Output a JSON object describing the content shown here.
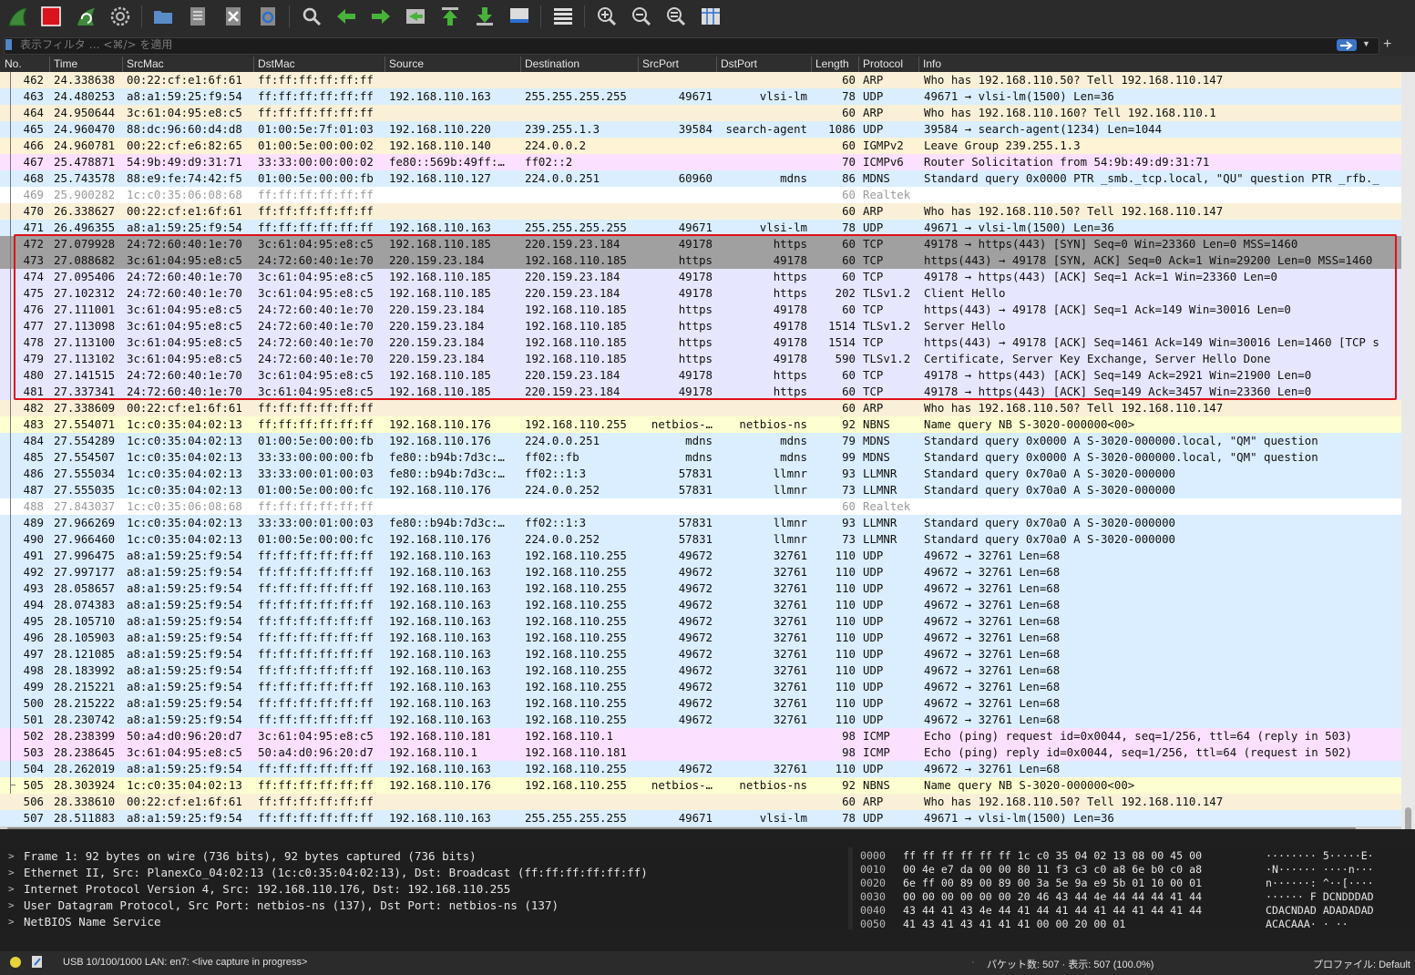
{
  "toolbar": {
    "buttons": [
      "shark-fin-start-icon",
      "stop-square-icon",
      "restart-capture-icon",
      "capture-options-gear-icon",
      "open-folder-icon",
      "save-file-icon",
      "close-file-icon",
      "reload-file-icon",
      "find-packet-icon",
      "go-back-arrow-icon",
      "go-forward-arrow-icon",
      "go-to-packet-icon",
      "go-first-packet-icon",
      "go-last-packet-icon",
      "autoscroll-icon",
      "colorize-icon",
      "zoom-in-icon",
      "zoom-out-icon",
      "zoom-normal-icon",
      "resize-columns-icon"
    ]
  },
  "filter": {
    "placeholder": "表示フィルタ … <⌘/> を適用"
  },
  "columns": [
    "No.",
    "Time",
    "SrcMac",
    "DstMac",
    "Source",
    "Destination",
    "SrcPort",
    "DstPort",
    "Length",
    "Protocol",
    "Info"
  ],
  "packets": [
    [
      "462",
      "24.338638",
      "00:22:cf:e1:6f:61",
      "ff:ff:ff:ff:ff:ff",
      "",
      "",
      "",
      "",
      "60",
      "ARP",
      "Who has 192.168.110.50? Tell 192.168.110.147",
      "arp"
    ],
    [
      "463",
      "24.480253",
      "a8:a1:59:25:f9:54",
      "ff:ff:ff:ff:ff:ff",
      "192.168.110.163",
      "255.255.255.255",
      "49671",
      "vlsi-lm",
      "78",
      "UDP",
      "49671 → vlsi-lm(1500) Len=36",
      "udp"
    ],
    [
      "464",
      "24.950644",
      "3c:61:04:95:e8:c5",
      "ff:ff:ff:ff:ff:ff",
      "",
      "",
      "",
      "",
      "60",
      "ARP",
      "Who has 192.168.110.160? Tell 192.168.110.1",
      "arp"
    ],
    [
      "465",
      "24.960470",
      "88:dc:96:60:d4:d8",
      "01:00:5e:7f:01:03",
      "192.168.110.220",
      "239.255.1.3",
      "39584",
      "search-agent",
      "1086",
      "UDP",
      "39584 → search-agent(1234) Len=1044",
      "udp"
    ],
    [
      "466",
      "24.960781",
      "00:22:cf:e6:82:65",
      "01:00:5e:00:00:02",
      "192.168.110.140",
      "224.0.0.2",
      "",
      "",
      "60",
      "IGMPv2",
      "Leave Group 239.255.1.3",
      "igmp"
    ],
    [
      "467",
      "25.478871",
      "54:9b:49:d9:31:71",
      "33:33:00:00:00:02",
      "fe80::569b:49ff:…",
      "ff02::2",
      "",
      "",
      "70",
      "ICMPv6",
      "Router Solicitation from 54:9b:49:d9:31:71",
      "icmp"
    ],
    [
      "468",
      "25.743578",
      "88:e9:fe:74:42:f5",
      "01:00:5e:00:00:fb",
      "192.168.110.127",
      "224.0.0.251",
      "60960",
      "mdns",
      "86",
      "MDNS",
      "Standard query 0x0000 PTR _smb._tcp.local, \"QU\" question PTR _rfb._",
      "udp"
    ],
    [
      "469",
      "25.900282",
      "1c:c0:35:06:08:68",
      "ff:ff:ff:ff:ff:ff",
      "",
      "",
      "",
      "",
      "60",
      "Realtek",
      "",
      "rtk"
    ],
    [
      "470",
      "26.338627",
      "00:22:cf:e1:6f:61",
      "ff:ff:ff:ff:ff:ff",
      "",
      "",
      "",
      "",
      "60",
      "ARP",
      "Who has 192.168.110.50? Tell 192.168.110.147",
      "arp"
    ],
    [
      "471",
      "26.496355",
      "a8:a1:59:25:f9:54",
      "ff:ff:ff:ff:ff:ff",
      "192.168.110.163",
      "255.255.255.255",
      "49671",
      "vlsi-lm",
      "78",
      "UDP",
      "49671 → vlsi-lm(1500) Len=36",
      "udp"
    ],
    [
      "472",
      "27.079928",
      "24:72:60:40:1e:70",
      "3c:61:04:95:e8:c5",
      "192.168.110.185",
      "220.159.23.184",
      "49178",
      "https",
      "60",
      "TCP",
      "49178 → https(443) [SYN] Seq=0 Win=23360 Len=0 MSS=1460",
      "syn"
    ],
    [
      "473",
      "27.088682",
      "3c:61:04:95:e8:c5",
      "24:72:60:40:1e:70",
      "220.159.23.184",
      "192.168.110.185",
      "https",
      "49178",
      "60",
      "TCP",
      "https(443) → 49178 [SYN, ACK] Seq=0 Ack=1 Win=29200 Len=0 MSS=1460",
      "syn"
    ],
    [
      "474",
      "27.095406",
      "24:72:60:40:1e:70",
      "3c:61:04:95:e8:c5",
      "192.168.110.185",
      "220.159.23.184",
      "49178",
      "https",
      "60",
      "TCP",
      "49178 → https(443) [ACK] Seq=1 Ack=1 Win=23360 Len=0",
      "tcp"
    ],
    [
      "475",
      "27.102312",
      "24:72:60:40:1e:70",
      "3c:61:04:95:e8:c5",
      "192.168.110.185",
      "220.159.23.184",
      "49178",
      "https",
      "202",
      "TLSv1.2",
      "Client Hello",
      "tcp"
    ],
    [
      "476",
      "27.111001",
      "3c:61:04:95:e8:c5",
      "24:72:60:40:1e:70",
      "220.159.23.184",
      "192.168.110.185",
      "https",
      "49178",
      "60",
      "TCP",
      "https(443) → 49178 [ACK] Seq=1 Ack=149 Win=30016 Len=0",
      "tcp"
    ],
    [
      "477",
      "27.113098",
      "3c:61:04:95:e8:c5",
      "24:72:60:40:1e:70",
      "220.159.23.184",
      "192.168.110.185",
      "https",
      "49178",
      "1514",
      "TLSv1.2",
      "Server Hello",
      "tcp"
    ],
    [
      "478",
      "27.113100",
      "3c:61:04:95:e8:c5",
      "24:72:60:40:1e:70",
      "220.159.23.184",
      "192.168.110.185",
      "https",
      "49178",
      "1514",
      "TCP",
      "https(443) → 49178 [ACK] Seq=1461 Ack=149 Win=30016 Len=1460 [TCP s",
      "tcp"
    ],
    [
      "479",
      "27.113102",
      "3c:61:04:95:e8:c5",
      "24:72:60:40:1e:70",
      "220.159.23.184",
      "192.168.110.185",
      "https",
      "49178",
      "590",
      "TLSv1.2",
      "Certificate, Server Key Exchange, Server Hello Done",
      "tcp"
    ],
    [
      "480",
      "27.141515",
      "24:72:60:40:1e:70",
      "3c:61:04:95:e8:c5",
      "192.168.110.185",
      "220.159.23.184",
      "49178",
      "https",
      "60",
      "TCP",
      "49178 → https(443) [ACK] Seq=149 Ack=2921 Win=21900 Len=0",
      "tcp"
    ],
    [
      "481",
      "27.337341",
      "24:72:60:40:1e:70",
      "3c:61:04:95:e8:c5",
      "192.168.110.185",
      "220.159.23.184",
      "49178",
      "https",
      "60",
      "TCP",
      "49178 → https(443) [ACK] Seq=149 Ack=3457 Win=23360 Len=0",
      "tcp"
    ],
    [
      "482",
      "27.338609",
      "00:22:cf:e1:6f:61",
      "ff:ff:ff:ff:ff:ff",
      "",
      "",
      "",
      "",
      "60",
      "ARP",
      "Who has 192.168.110.50? Tell 192.168.110.147",
      "arp"
    ],
    [
      "483",
      "27.554071",
      "1c:c0:35:04:02:13",
      "ff:ff:ff:ff:ff:ff",
      "192.168.110.176",
      "192.168.110.255",
      "netbios-…",
      "netbios-ns",
      "92",
      "NBNS",
      "Name query NB S-3020-000000<00>",
      "nbns"
    ],
    [
      "484",
      "27.554289",
      "1c:c0:35:04:02:13",
      "01:00:5e:00:00:fb",
      "192.168.110.176",
      "224.0.0.251",
      "mdns",
      "mdns",
      "79",
      "MDNS",
      "Standard query 0x0000 A S-3020-000000.local, \"QM\" question",
      "udp"
    ],
    [
      "485",
      "27.554507",
      "1c:c0:35:04:02:13",
      "33:33:00:00:00:fb",
      "fe80::b94b:7d3c:…",
      "ff02::fb",
      "mdns",
      "mdns",
      "99",
      "MDNS",
      "Standard query 0x0000 A S-3020-000000.local, \"QM\" question",
      "udp"
    ],
    [
      "486",
      "27.555034",
      "1c:c0:35:04:02:13",
      "33:33:00:01:00:03",
      "fe80::b94b:7d3c:…",
      "ff02::1:3",
      "57831",
      "llmnr",
      "93",
      "LLMNR",
      "Standard query 0x70a0 A S-3020-000000",
      "udp"
    ],
    [
      "487",
      "27.555035",
      "1c:c0:35:04:02:13",
      "01:00:5e:00:00:fc",
      "192.168.110.176",
      "224.0.0.252",
      "57831",
      "llmnr",
      "73",
      "LLMNR",
      "Standard query 0x70a0 A S-3020-000000",
      "udp"
    ],
    [
      "488",
      "27.843037",
      "1c:c0:35:06:08:68",
      "ff:ff:ff:ff:ff:ff",
      "",
      "",
      "",
      "",
      "60",
      "Realtek",
      "",
      "rtk"
    ],
    [
      "489",
      "27.966269",
      "1c:c0:35:04:02:13",
      "33:33:00:01:00:03",
      "fe80::b94b:7d3c:…",
      "ff02::1:3",
      "57831",
      "llmnr",
      "93",
      "LLMNR",
      "Standard query 0x70a0 A S-3020-000000",
      "udp"
    ],
    [
      "490",
      "27.966460",
      "1c:c0:35:04:02:13",
      "01:00:5e:00:00:fc",
      "192.168.110.176",
      "224.0.0.252",
      "57831",
      "llmnr",
      "73",
      "LLMNR",
      "Standard query 0x70a0 A S-3020-000000",
      "udp"
    ],
    [
      "491",
      "27.996475",
      "a8:a1:59:25:f9:54",
      "ff:ff:ff:ff:ff:ff",
      "192.168.110.163",
      "192.168.110.255",
      "49672",
      "32761",
      "110",
      "UDP",
      "49672 → 32761 Len=68",
      "udp"
    ],
    [
      "492",
      "27.997177",
      "a8:a1:59:25:f9:54",
      "ff:ff:ff:ff:ff:ff",
      "192.168.110.163",
      "192.168.110.255",
      "49672",
      "32761",
      "110",
      "UDP",
      "49672 → 32761 Len=68",
      "udp"
    ],
    [
      "493",
      "28.058657",
      "a8:a1:59:25:f9:54",
      "ff:ff:ff:ff:ff:ff",
      "192.168.110.163",
      "192.168.110.255",
      "49672",
      "32761",
      "110",
      "UDP",
      "49672 → 32761 Len=68",
      "udp"
    ],
    [
      "494",
      "28.074383",
      "a8:a1:59:25:f9:54",
      "ff:ff:ff:ff:ff:ff",
      "192.168.110.163",
      "192.168.110.255",
      "49672",
      "32761",
      "110",
      "UDP",
      "49672 → 32761 Len=68",
      "udp"
    ],
    [
      "495",
      "28.105710",
      "a8:a1:59:25:f9:54",
      "ff:ff:ff:ff:ff:ff",
      "192.168.110.163",
      "192.168.110.255",
      "49672",
      "32761",
      "110",
      "UDP",
      "49672 → 32761 Len=68",
      "udp"
    ],
    [
      "496",
      "28.105903",
      "a8:a1:59:25:f9:54",
      "ff:ff:ff:ff:ff:ff",
      "192.168.110.163",
      "192.168.110.255",
      "49672",
      "32761",
      "110",
      "UDP",
      "49672 → 32761 Len=68",
      "udp"
    ],
    [
      "497",
      "28.121085",
      "a8:a1:59:25:f9:54",
      "ff:ff:ff:ff:ff:ff",
      "192.168.110.163",
      "192.168.110.255",
      "49672",
      "32761",
      "110",
      "UDP",
      "49672 → 32761 Len=68",
      "udp"
    ],
    [
      "498",
      "28.183992",
      "a8:a1:59:25:f9:54",
      "ff:ff:ff:ff:ff:ff",
      "192.168.110.163",
      "192.168.110.255",
      "49672",
      "32761",
      "110",
      "UDP",
      "49672 → 32761 Len=68",
      "udp"
    ],
    [
      "499",
      "28.215221",
      "a8:a1:59:25:f9:54",
      "ff:ff:ff:ff:ff:ff",
      "192.168.110.163",
      "192.168.110.255",
      "49672",
      "32761",
      "110",
      "UDP",
      "49672 → 32761 Len=68",
      "udp"
    ],
    [
      "500",
      "28.215222",
      "a8:a1:59:25:f9:54",
      "ff:ff:ff:ff:ff:ff",
      "192.168.110.163",
      "192.168.110.255",
      "49672",
      "32761",
      "110",
      "UDP",
      "49672 → 32761 Len=68",
      "udp"
    ],
    [
      "501",
      "28.230742",
      "a8:a1:59:25:f9:54",
      "ff:ff:ff:ff:ff:ff",
      "192.168.110.163",
      "192.168.110.255",
      "49672",
      "32761",
      "110",
      "UDP",
      "49672 → 32761 Len=68",
      "udp"
    ],
    [
      "502",
      "28.238399",
      "50:a4:d0:96:20:d7",
      "3c:61:04:95:e8:c5",
      "192.168.110.181",
      "192.168.110.1",
      "",
      "",
      "98",
      "ICMP",
      "Echo (ping) request  id=0x0044, seq=1/256, ttl=64 (reply in 503)",
      "icmp"
    ],
    [
      "503",
      "28.238645",
      "3c:61:04:95:e8:c5",
      "50:a4:d0:96:20:d7",
      "192.168.110.1",
      "192.168.110.181",
      "",
      "",
      "98",
      "ICMP",
      "Echo (ping) reply    id=0x0044, seq=1/256, ttl=64 (request in 502)",
      "icmp"
    ],
    [
      "504",
      "28.262019",
      "a8:a1:59:25:f9:54",
      "ff:ff:ff:ff:ff:ff",
      "192.168.110.163",
      "192.168.110.255",
      "49672",
      "32761",
      "110",
      "UDP",
      "49672 → 32761 Len=68",
      "udp"
    ],
    [
      "505",
      "28.303924",
      "1c:c0:35:04:02:13",
      "ff:ff:ff:ff:ff:ff",
      "192.168.110.176",
      "192.168.110.255",
      "netbios-…",
      "netbios-ns",
      "92",
      "NBNS",
      "Name query NB S-3020-000000<00>",
      "nbns"
    ],
    [
      "506",
      "28.338610",
      "00:22:cf:e1:6f:61",
      "ff:ff:ff:ff:ff:ff",
      "",
      "",
      "",
      "",
      "60",
      "ARP",
      "Who has 192.168.110.50? Tell 192.168.110.147",
      "arp"
    ],
    [
      "507",
      "28.511883",
      "a8:a1:59:25:f9:54",
      "ff:ff:ff:ff:ff:ff",
      "192.168.110.163",
      "255.255.255.255",
      "49671",
      "vlsi-lm",
      "78",
      "UDP",
      "49671 → vlsi-lm(1500) Len=36",
      "udp"
    ]
  ],
  "row_colors": {
    "arp": "#faf0d7",
    "udp": "#daeeff",
    "igmp": "#fff3d6",
    "icmp": "#fce0ff",
    "rtk": "#ffffff",
    "syn": "#a0a0a0",
    "tcp": "#e7e6ff",
    "nbns": "#feffd0"
  },
  "details": [
    "Frame 1: 92 bytes on wire (736 bits), 92 bytes captured (736 bits)",
    "Ethernet II, Src: PlanexCo_04:02:13 (1c:c0:35:04:02:13), Dst: Broadcast (ff:ff:ff:ff:ff:ff)",
    "Internet Protocol Version 4, Src: 192.168.110.176, Dst: 192.168.110.255",
    "User Datagram Protocol, Src Port: netbios-ns (137), Dst Port: netbios-ns (137)",
    "NetBIOS Name Service"
  ],
  "bytes": [
    [
      "0000",
      "ff ff ff ff ff ff 1c c0  35 04 02 13 08 00 45 00",
      "········ 5·····E·"
    ],
    [
      "0010",
      "00 4e e7 da 00 00 80 11  f3 c3 c0 a8 6e b0 c0 a8",
      "·N······ ····n···"
    ],
    [
      "0020",
      "6e ff 00 89 00 89 00 3a  5e 9a e9 5b 01 10 00 01",
      "n······: ^··[····"
    ],
    [
      "0030",
      "00 00 00 00 00 00 20 46  43 44 4e 44 44 44 41 44",
      "······ F DCNDDDAD"
    ],
    [
      "0040",
      "43 44 41 43 4e 44 41 44  41 44 41 44 41 44 41 44",
      "CDACNDAD ADADADAD"
    ],
    [
      "0050",
      "41 43 41 43 41 41 41 00  00 20 00 01",
      "ACACAAA· · ··"
    ]
  ],
  "status": {
    "interface": "USB 10/100/1000 LAN: en7: <live capture in progress>",
    "counts": "パケット数: 507 · 表示: 507 (100.0%)",
    "profile": "プロファイル: Default"
  }
}
